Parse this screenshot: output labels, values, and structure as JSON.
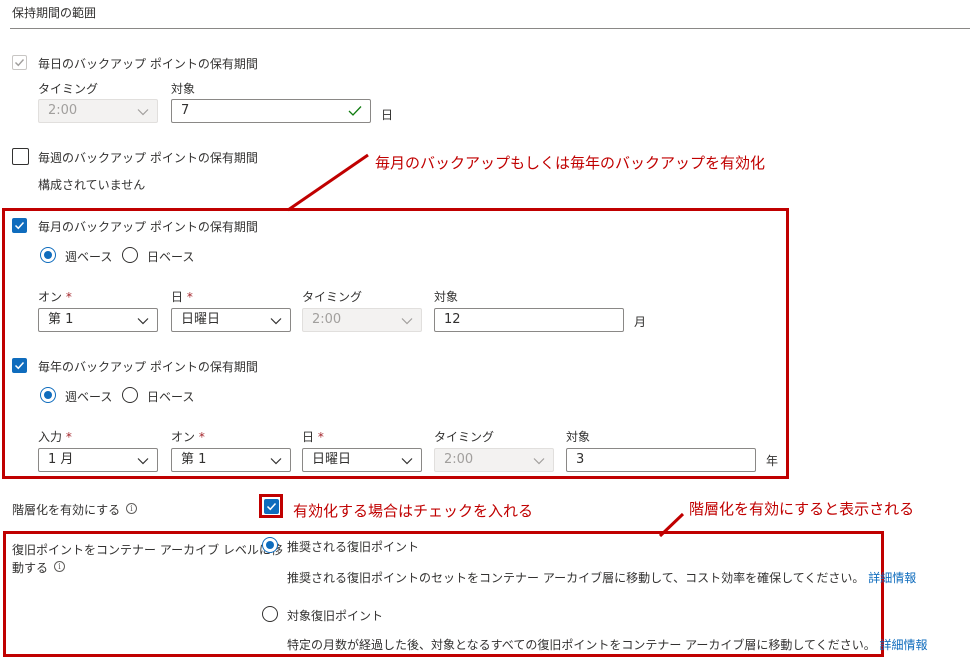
{
  "section": {
    "title": "保持期間の範囲"
  },
  "daily": {
    "label": "毎日のバックアップ ポイントの保有期間",
    "timing_label": "タイミング",
    "timing_value": "2:00",
    "target_label": "対象",
    "target_value": "7",
    "unit": "日"
  },
  "weekly": {
    "label": "毎週のバックアップ ポイントの保有期間",
    "status": "構成されていません"
  },
  "monthly": {
    "label": "毎月のバックアップ ポイントの保有期間",
    "radio_week": "週ベース",
    "radio_day": "日ベース",
    "on_label": "オン",
    "on_value": "第 1",
    "day_label": "日",
    "day_value": "日曜日",
    "timing_label": "タイミング",
    "timing_value": "2:00",
    "target_label": "対象",
    "target_value": "12",
    "unit": "月"
  },
  "yearly": {
    "label": "毎年のバックアップ ポイントの保有期間",
    "radio_week": "週ベース",
    "radio_day": "日ベース",
    "input_label": "入力",
    "input_value": "1 月",
    "on_label": "オン",
    "on_value": "第 1",
    "day_label": "日",
    "day_value": "日曜日",
    "timing_label": "タイミング",
    "timing_value": "2:00",
    "target_label": "対象",
    "target_value": "3",
    "unit": "年"
  },
  "tiering": {
    "label": "階層化を有効にする",
    "move_label_line1": "復旧ポイントをコンテナー アーカイブ レベルに移",
    "move_label_line2": "動する",
    "option1_label": "推奨される復旧ポイント",
    "option1_desc": "推奨される復旧ポイントのセットをコンテナー アーカイブ層に移動して、コスト効率を確保してください。",
    "option2_label": "対象復旧ポイント",
    "option2_desc": "特定の月数が経過した後、対象となるすべての復旧ポイントをコンテナー アーカイブ層に移動してください。",
    "learn_more": "詳細情報"
  },
  "annotations": {
    "monthly_yearly": "毎月のバックアップもしくは毎年のバックアップを有効化",
    "check_tiering": "有効化する場合はチェックを入れる",
    "tiering_shown": "階層化を有効にすると表示される"
  },
  "colors": {
    "accent": "#0f6cbd",
    "annotation_red": "#c00000"
  }
}
